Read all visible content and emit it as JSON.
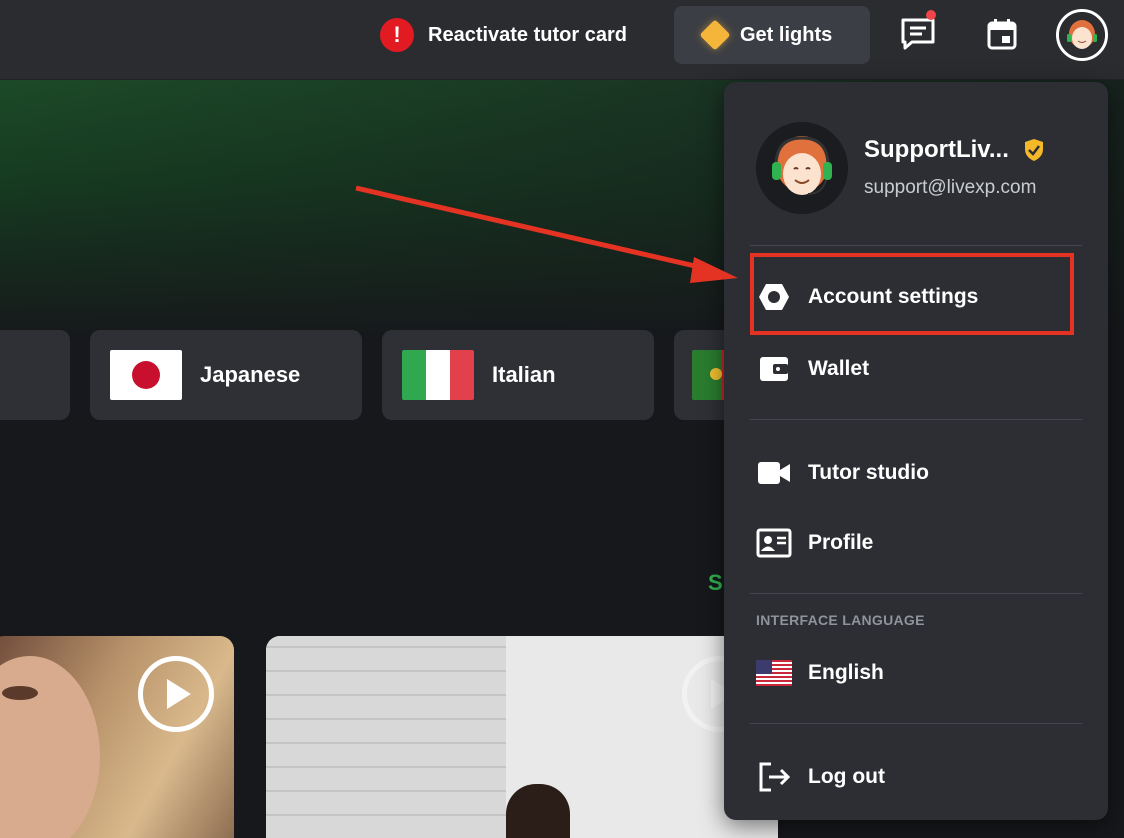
{
  "topbar": {
    "reactivate_label": "Reactivate tutor card",
    "alert_icon": "exclamation-icon",
    "lights_label": "Get lights",
    "messages_icon": "chat-icon",
    "calendar_icon": "calendar-icon"
  },
  "languages": [
    {
      "label": "Japanese",
      "flag": "japan-flag"
    },
    {
      "label": "Italian",
      "flag": "italy-flag"
    }
  ],
  "partial_text": "S",
  "dropdown": {
    "user_name": "SupportLiv...",
    "user_email": "support@livexp.com",
    "items": [
      {
        "label": "Account settings",
        "icon": "hexagon-settings-icon"
      },
      {
        "label": "Wallet",
        "icon": "wallet-icon"
      },
      {
        "label": "Tutor studio",
        "icon": "video-camera-icon"
      },
      {
        "label": "Profile",
        "icon": "id-card-icon"
      }
    ],
    "interface_language_heading": "INTERFACE LANGUAGE",
    "language": "English",
    "logout_label": "Log out"
  },
  "colors": {
    "accent_green": "#2fb351",
    "alert_red": "#e21b23",
    "annotation_red": "#e53323",
    "lights_gold": "#f5b53b"
  }
}
